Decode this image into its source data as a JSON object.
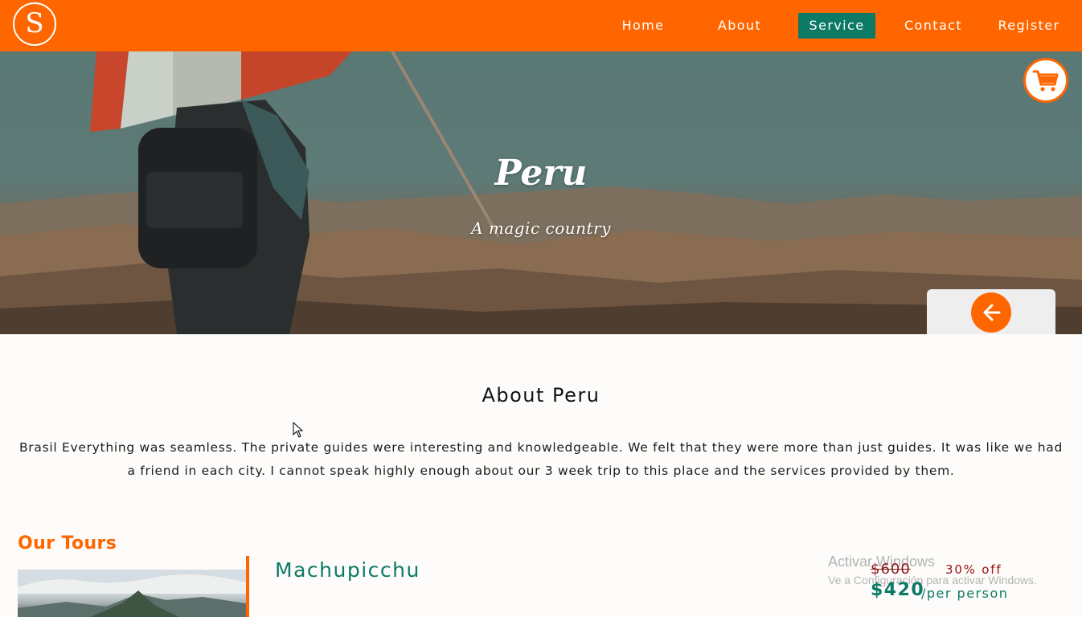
{
  "brand": {
    "logo_letter": "S"
  },
  "nav": {
    "items": [
      {
        "label": "Home"
      },
      {
        "label": "About"
      },
      {
        "label": "Service",
        "active": true
      },
      {
        "label": "Contact"
      },
      {
        "label": "Register"
      }
    ]
  },
  "hero": {
    "title": "Peru",
    "subtitle": "A magic country",
    "cart_icon": "shopping-cart-icon",
    "back_icon": "arrow-left-icon"
  },
  "about": {
    "title": "About Peru",
    "text": "Brasil Everything was seamless. The private guides were interesting and knowledgeable. We felt that they were more than just guides. It was like we had a friend in each city. I cannot speak highly enough about our 3 week trip to this place and the services provided by them."
  },
  "tours": {
    "heading": "Our Tours",
    "items": [
      {
        "name": "Machupicchu",
        "old_price": "$600",
        "discount": "30% off",
        "price": "$420",
        "price_unit": "/per person"
      }
    ]
  },
  "watermark": {
    "title": "Activar Windows",
    "subtitle": "Ve a Configuración para activar Windows."
  },
  "colors": {
    "brand_orange": "#ff6600",
    "accent_teal": "#0d7a66",
    "discount_red": "#9b1010"
  }
}
